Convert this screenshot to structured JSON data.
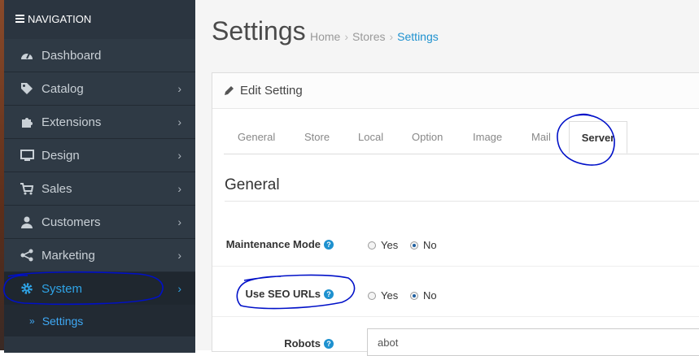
{
  "sidebar": {
    "header": "NAVIGATION",
    "items": [
      {
        "label": "Dashboard",
        "icon": "dashboard-icon",
        "has_children": false
      },
      {
        "label": "Catalog",
        "icon": "tag-icon",
        "has_children": true
      },
      {
        "label": "Extensions",
        "icon": "puzzle-icon",
        "has_children": true
      },
      {
        "label": "Design",
        "icon": "monitor-icon",
        "has_children": true
      },
      {
        "label": "Sales",
        "icon": "cart-icon",
        "has_children": true
      },
      {
        "label": "Customers",
        "icon": "user-icon",
        "has_children": true
      },
      {
        "label": "Marketing",
        "icon": "share-icon",
        "has_children": true
      },
      {
        "label": "System",
        "icon": "gear-icon",
        "has_children": true,
        "active": true
      }
    ],
    "sub_item": "Settings"
  },
  "header": {
    "title": "Settings",
    "breadcrumb": [
      "Home",
      "Stores",
      "Settings"
    ]
  },
  "panel": {
    "title": "Edit Setting",
    "tabs": [
      "General",
      "Store",
      "Local",
      "Option",
      "Image",
      "Mail",
      "Server"
    ],
    "active_tab": "Server",
    "section_title": "General",
    "fields": {
      "maintenance": {
        "label": "Maintenance Mode",
        "options": [
          "Yes",
          "No"
        ],
        "selected": "No"
      },
      "seo": {
        "label": "Use SEO URLs",
        "options": [
          "Yes",
          "No"
        ],
        "selected": "No"
      },
      "robots": {
        "label": "Robots",
        "value": "abot"
      }
    }
  },
  "colors": {
    "accent": "#1e91cf",
    "sidebar_bg": "#2b3540",
    "annotation": "#0010c8"
  }
}
